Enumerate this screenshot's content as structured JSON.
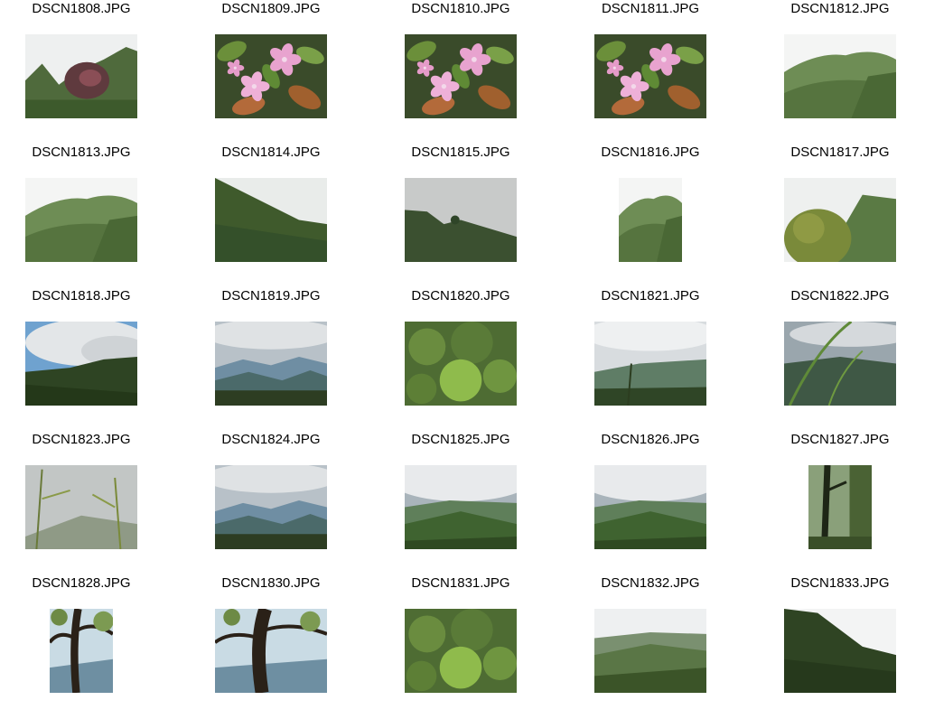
{
  "gallery": {
    "items": [
      {
        "filename": "DSCN1808.JPG",
        "orientation": "landscape",
        "scene": "shrub-bright-sky"
      },
      {
        "filename": "DSCN1809.JPG",
        "orientation": "landscape",
        "scene": "flowers-leaves"
      },
      {
        "filename": "DSCN1810.JPG",
        "orientation": "landscape",
        "scene": "flowers-leaves"
      },
      {
        "filename": "DSCN1811.JPG",
        "orientation": "landscape",
        "scene": "flowers-leaves"
      },
      {
        "filename": "DSCN1812.JPG",
        "orientation": "landscape",
        "scene": "green-ridge-mist"
      },
      {
        "filename": "DSCN1813.JPG",
        "orientation": "landscape",
        "scene": "green-ridge-mist"
      },
      {
        "filename": "DSCN1814.JPG",
        "orientation": "landscape",
        "scene": "dark-slope"
      },
      {
        "filename": "DSCN1815.JPG",
        "orientation": "landscape",
        "scene": "gray-sky-hill"
      },
      {
        "filename": "DSCN1816.JPG",
        "orientation": "portrait",
        "scene": "green-ridge-mist"
      },
      {
        "filename": "DSCN1817.JPG",
        "orientation": "landscape",
        "scene": "tree-ridge"
      },
      {
        "filename": "DSCN1818.JPG",
        "orientation": "landscape",
        "scene": "cloud-blue-sky"
      },
      {
        "filename": "DSCN1819.JPG",
        "orientation": "landscape",
        "scene": "blue-mountains"
      },
      {
        "filename": "DSCN1820.JPG",
        "orientation": "landscape",
        "scene": "forest-canopy"
      },
      {
        "filename": "DSCN1821.JPG",
        "orientation": "landscape",
        "scene": "valley-vegetation"
      },
      {
        "filename": "DSCN1822.JPG",
        "orientation": "landscape",
        "scene": "bamboo-valley"
      },
      {
        "filename": "DSCN1823.JPG",
        "orientation": "landscape",
        "scene": "bamboo-mist"
      },
      {
        "filename": "DSCN1824.JPG",
        "orientation": "landscape",
        "scene": "blue-mountains"
      },
      {
        "filename": "DSCN1825.JPG",
        "orientation": "landscape",
        "scene": "green-ridges-cloud"
      },
      {
        "filename": "DSCN1826.JPG",
        "orientation": "landscape",
        "scene": "green-ridges-cloud"
      },
      {
        "filename": "DSCN1827.JPG",
        "orientation": "portrait",
        "scene": "tree-trunk-forest"
      },
      {
        "filename": "DSCN1828.JPG",
        "orientation": "portrait",
        "scene": "tree-trunk-sky"
      },
      {
        "filename": "DSCN1830.JPG",
        "orientation": "landscape",
        "scene": "tree-trunk-sky"
      },
      {
        "filename": "DSCN1831.JPG",
        "orientation": "landscape",
        "scene": "forest-canopy"
      },
      {
        "filename": "DSCN1832.JPG",
        "orientation": "landscape",
        "scene": "misty-valley"
      },
      {
        "filename": "DSCN1833.JPG",
        "orientation": "landscape",
        "scene": "dark-slope-bright-sky"
      }
    ]
  }
}
